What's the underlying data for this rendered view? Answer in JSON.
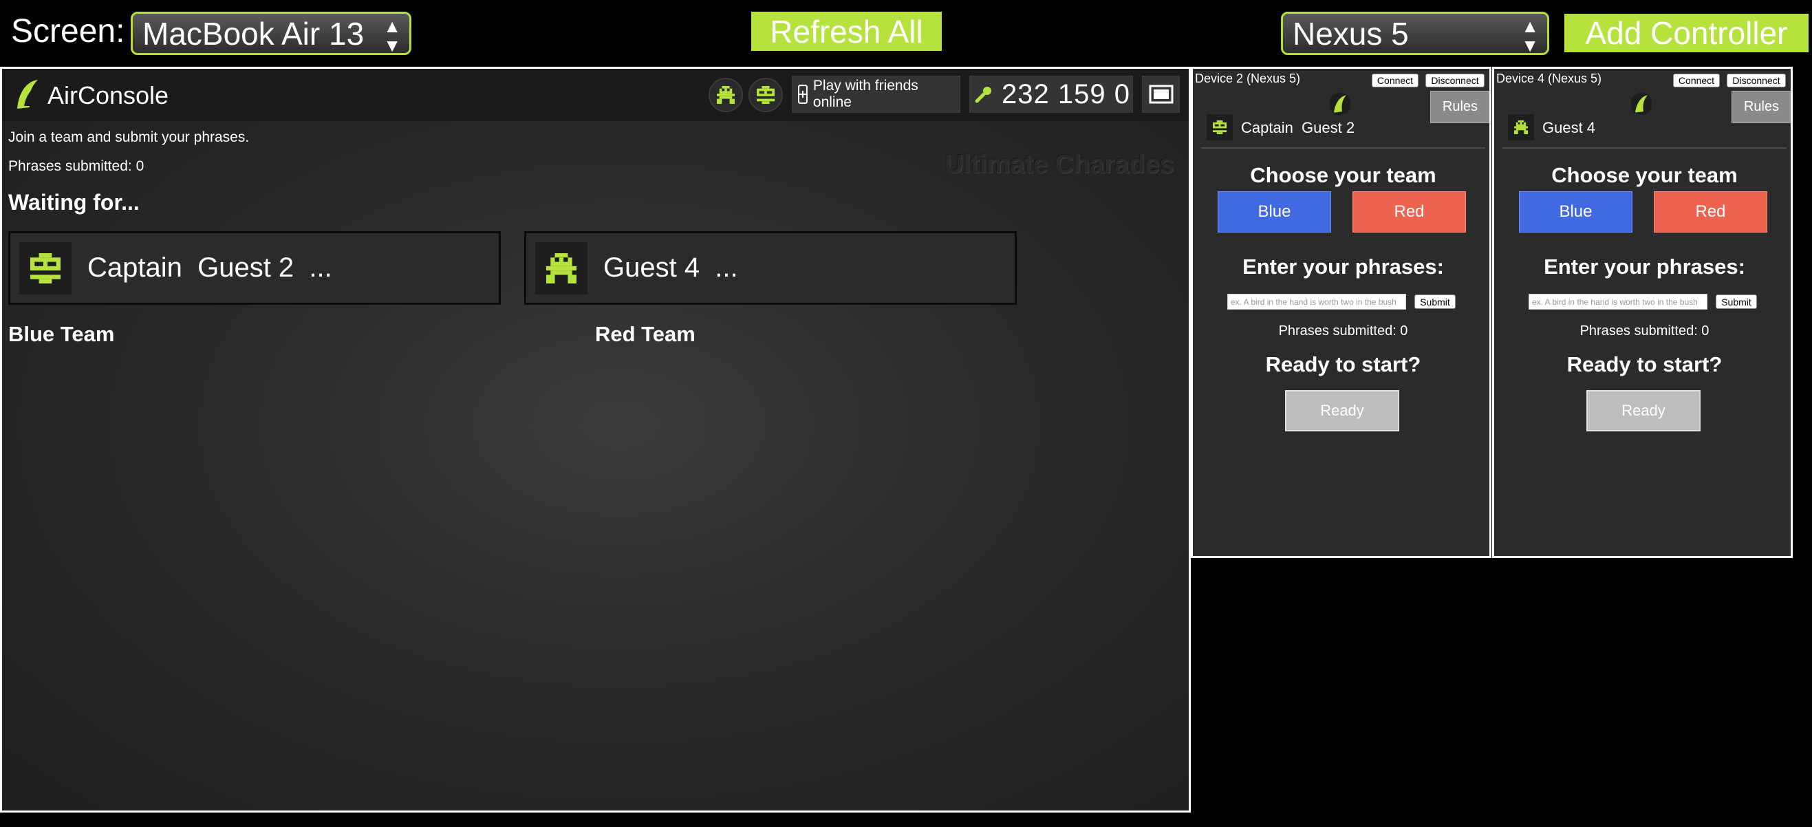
{
  "toolbar": {
    "screen_label": "Screen:",
    "screen_select": "MacBook Air 13",
    "refresh_label": "Refresh All",
    "device_select": "Nexus 5",
    "add_controller_label": "Add Controller"
  },
  "screen": {
    "brand": "AirConsole",
    "play_online": "Play with friends online",
    "code": "232 159 0",
    "instructions": "Join a team and submit your phrases.",
    "phrases_submitted": "Phrases submitted: 0",
    "game_title": "Ultimate Charades",
    "waiting": "Waiting for...",
    "players": [
      {
        "name": "Captain  Guest 2  ..."
      },
      {
        "name": "Guest 4  ..."
      }
    ],
    "team_blue": "Blue Team",
    "team_red": "Red Team"
  },
  "devices": [
    {
      "title": "Device 2 (Nexus 5)",
      "connect": "Connect",
      "disconnect": "Disconnect",
      "rules": "Rules",
      "player": "Captain  Guest 2",
      "choose_team": "Choose your team",
      "blue": "Blue",
      "red": "Red",
      "enter_phrases": "Enter your phrases:",
      "placeholder": "ex. A bird in the hand is worth two in the bush",
      "submit": "Submit",
      "phrases_submitted": "Phrases submitted: 0",
      "ready_question": "Ready to start?",
      "ready": "Ready"
    },
    {
      "title": "Device 4 (Nexus 5)",
      "connect": "Connect",
      "disconnect": "Disconnect",
      "rules": "Rules",
      "player": "Guest 4",
      "choose_team": "Choose your team",
      "blue": "Blue",
      "red": "Red",
      "enter_phrases": "Enter your phrases:",
      "placeholder": "ex. A bird in the hand is worth two in the bush",
      "submit": "Submit",
      "phrases_submitted": "Phrases submitted: 0",
      "ready_question": "Ready to start?",
      "ready": "Ready"
    }
  ],
  "colors": {
    "accent": "#b5e23c",
    "team_blue": "#4169e1",
    "team_red": "#ec6450"
  },
  "icons": [
    "airconsole-logo-icon",
    "pixel-robot-icon",
    "pixel-alien-icon",
    "phone-icon",
    "key-icon",
    "fullscreen-icon"
  ]
}
